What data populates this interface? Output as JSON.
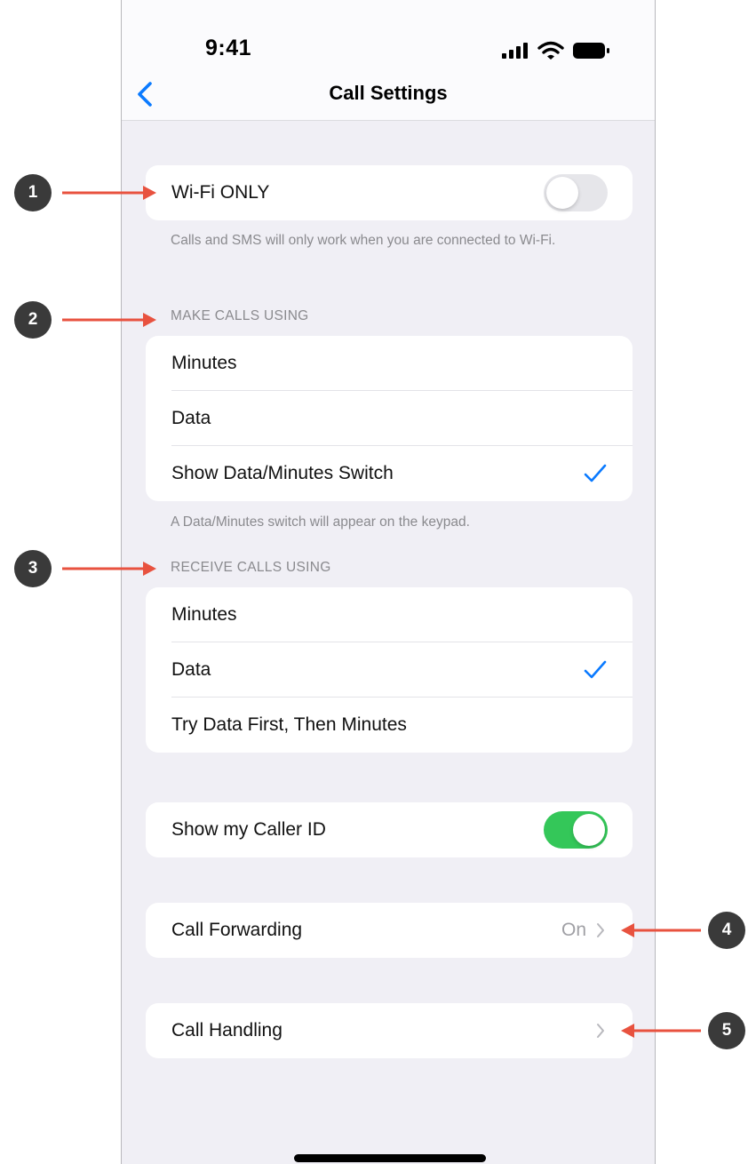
{
  "status_bar": {
    "time": "9:41",
    "icons": [
      "signal-icon",
      "wifi-icon",
      "battery-icon"
    ]
  },
  "nav": {
    "title": "Call Settings",
    "back_icon": "chevron-left-icon"
  },
  "wifi_only": {
    "label": "Wi-Fi ONLY",
    "toggle_on": false,
    "footnote": "Calls and SMS will only work when you are connected to Wi-Fi."
  },
  "make_calls": {
    "header": "MAKE CALLS USING",
    "options": [
      "Minutes",
      "Data",
      "Show Data/Minutes Switch"
    ],
    "selected": "Show Data/Minutes Switch",
    "footnote": "A Data/Minutes switch will appear on the keypad."
  },
  "receive_calls": {
    "header": "RECEIVE CALLS USING",
    "options": [
      "Minutes",
      "Data",
      "Try Data First, Then Minutes"
    ],
    "selected": "Data"
  },
  "caller_id": {
    "label": "Show my Caller ID",
    "toggle_on": true
  },
  "call_forwarding": {
    "label": "Call Forwarding",
    "value": "On"
  },
  "call_handling": {
    "label": "Call Handling"
  },
  "annotations": [
    "1",
    "2",
    "3",
    "4",
    "5"
  ],
  "colors": {
    "accent": "#0a7aff",
    "toggle_on": "#34c759",
    "toggle_off": "#e6e6ea",
    "annotation_arrow": "#e8523f",
    "annotation_badge": "#3a3a3a",
    "background": "#f0eff5"
  }
}
